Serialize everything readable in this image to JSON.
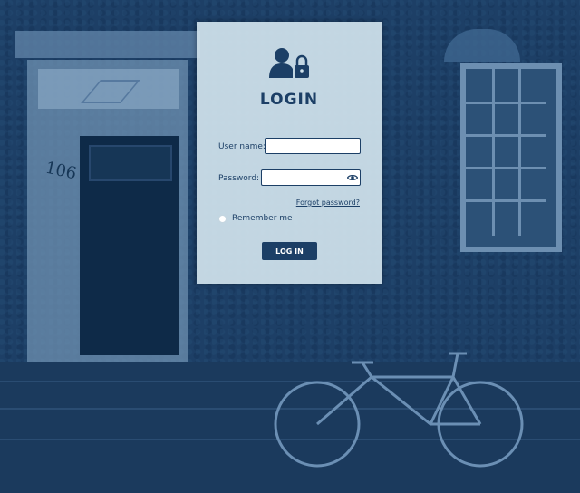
{
  "background": {
    "house_number": "106"
  },
  "login": {
    "title": "LOGIN",
    "username": {
      "label": "User name:",
      "value": "",
      "placeholder": ""
    },
    "password": {
      "label": "Password:",
      "value": "",
      "placeholder": ""
    },
    "forgot_password": "Forgot password?",
    "remember_me": {
      "label": "Remember me",
      "checked": false
    },
    "submit_label": "LOG IN"
  },
  "icons": {
    "header": "user-lock-icon",
    "password_toggle": "eye-icon"
  },
  "colors": {
    "accent": "#1c3f66",
    "card_background": "#d0e2ec",
    "page_background": "#1d3f66"
  }
}
